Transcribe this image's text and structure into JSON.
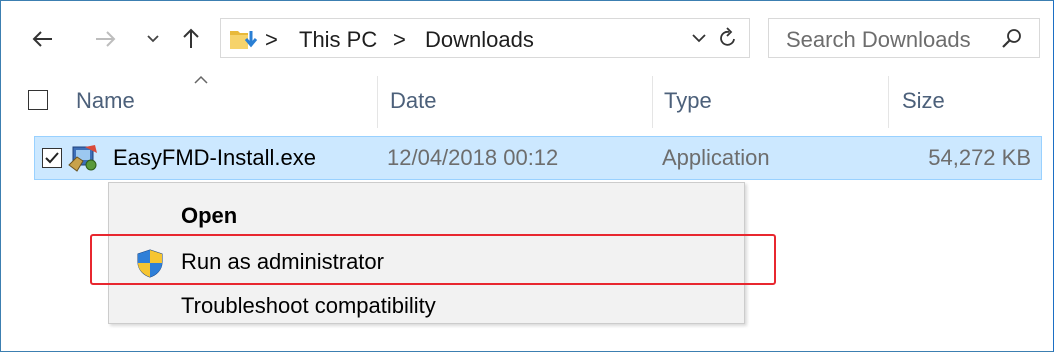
{
  "address_bar": {
    "breadcrumbs": [
      "This PC",
      "Downloads"
    ],
    "separator": ">"
  },
  "search": {
    "placeholder": "Search Downloads"
  },
  "columns": [
    "Name",
    "Date",
    "Type",
    "Size"
  ],
  "file": {
    "name": "EasyFMD-Install.exe",
    "date": "12/04/2018 00:12",
    "type": "Application",
    "size": "54,272 KB",
    "checked": true
  },
  "context_menu": {
    "items": [
      "Open",
      "Run as administrator",
      "Troubleshoot compatibility"
    ],
    "highlighted": "Run as administrator"
  },
  "colors": {
    "selection_bg": "#cce8ff",
    "selection_border": "#99d1ff",
    "highlight_box": "#e8272f",
    "column_header_text": "#4c607a"
  },
  "icons": {
    "back": "back-arrow-icon",
    "forward": "forward-arrow-icon",
    "recent": "chevron-down-icon",
    "up": "up-arrow-icon",
    "folder": "downloads-folder-icon",
    "refresh": "refresh-icon",
    "search": "search-icon",
    "shield": "uac-shield-icon",
    "app": "application-icon"
  }
}
